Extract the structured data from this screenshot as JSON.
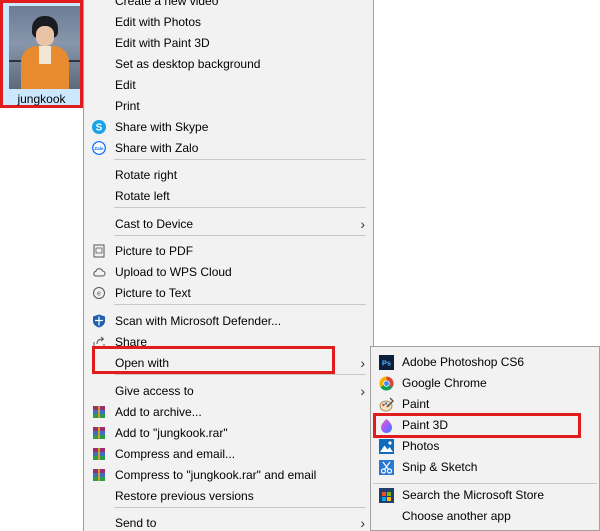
{
  "file": {
    "name": "jungkook"
  },
  "menu": {
    "items": [
      {
        "label": "Create a new video"
      },
      {
        "label": "Edit with Photos"
      },
      {
        "label": "Edit with Paint 3D"
      },
      {
        "label": "Set as desktop background"
      },
      {
        "label": "Edit"
      },
      {
        "label": "Print"
      },
      {
        "label": "Share with Skype",
        "icon": "skype-icon"
      },
      {
        "label": "Share with Zalo",
        "icon": "zalo-icon"
      },
      {
        "label": "Rotate right"
      },
      {
        "label": "Rotate left"
      },
      {
        "label": "Cast to Device",
        "has_submenu": true
      },
      {
        "label": "Picture to PDF",
        "icon": "pdf-icon"
      },
      {
        "label": "Upload to WPS Cloud",
        "icon": "cloud-icon"
      },
      {
        "label": "Picture to Text",
        "icon": "ocr-icon"
      },
      {
        "label": "Scan with Microsoft Defender...",
        "icon": "defender-shield-icon"
      },
      {
        "label": "Share",
        "icon": "share-icon"
      },
      {
        "label": "Open with",
        "has_submenu": true
      },
      {
        "label": "Give access to",
        "has_submenu": true
      },
      {
        "label": "Add to archive...",
        "icon": "winrar-icon"
      },
      {
        "label": "Add to \"jungkook.rar\"",
        "icon": "winrar-icon"
      },
      {
        "label": "Compress and email...",
        "icon": "winrar-icon"
      },
      {
        "label": "Compress to \"jungkook.rar\" and email",
        "icon": "winrar-icon"
      },
      {
        "label": "Restore previous versions"
      },
      {
        "label": "Send to",
        "has_submenu": true
      }
    ]
  },
  "submenu": {
    "items": [
      {
        "label": "Adobe Photoshop CS6",
        "icon": "photoshop-icon"
      },
      {
        "label": "Google Chrome",
        "icon": "chrome-icon"
      },
      {
        "label": "Paint",
        "icon": "paint-icon"
      },
      {
        "label": "Paint 3D",
        "icon": "paint3d-icon"
      },
      {
        "label": "Photos",
        "icon": "photos-icon"
      },
      {
        "label": "Snip & Sketch",
        "icon": "snip-sketch-icon"
      },
      {
        "label": "Search the Microsoft Store",
        "icon": "store-icon"
      },
      {
        "label": "Choose another app"
      }
    ]
  },
  "colors": {
    "highlight": "#e01c1c",
    "selection": "#cce8ff",
    "menu_bg": "#f2f2f2"
  }
}
